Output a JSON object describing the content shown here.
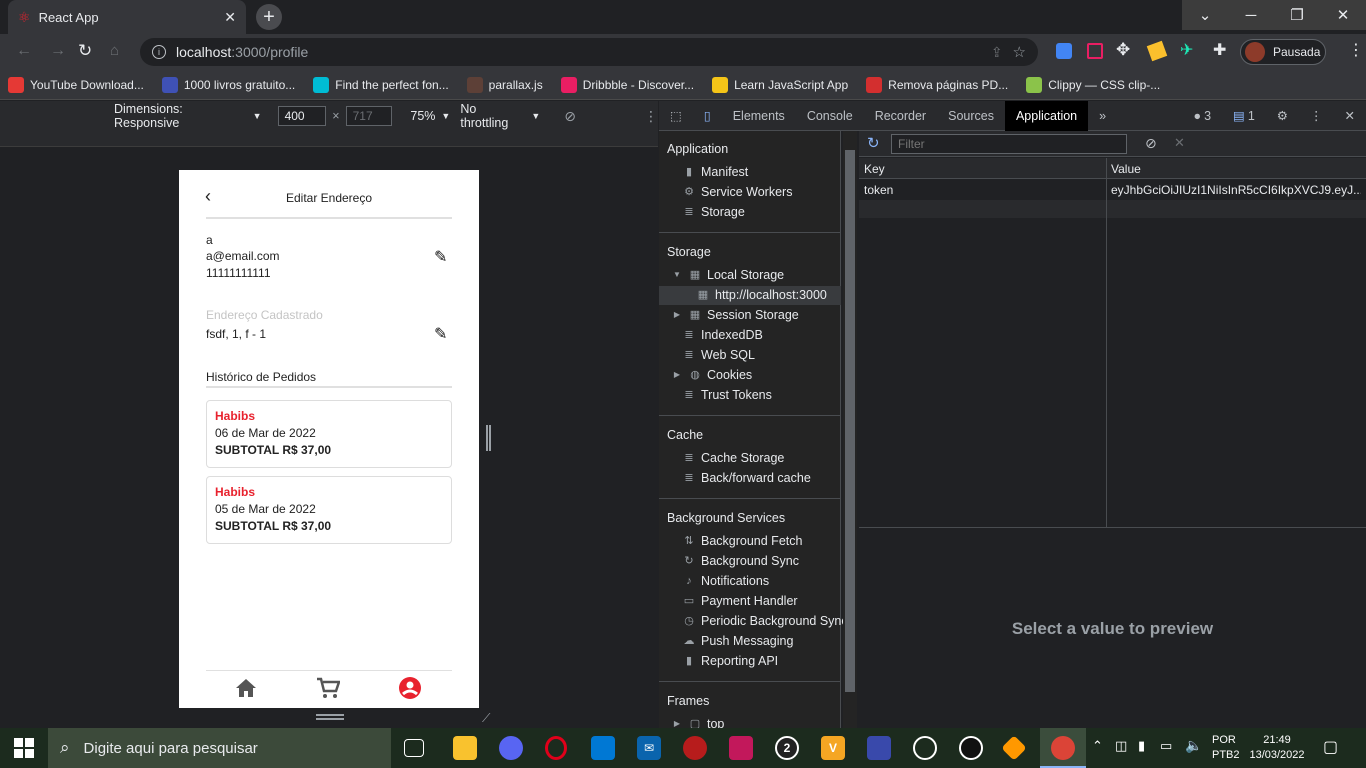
{
  "browser": {
    "tab_title": "React App",
    "url_host": "localhost",
    "url_rest": ":3000/profile",
    "profile_label": "Pausada",
    "bookmarks": [
      {
        "label": "YouTube Download...",
        "color": "#e53935"
      },
      {
        "label": "1000 livros gratuito...",
        "color": "#3f51b5"
      },
      {
        "label": "Find the perfect fon...",
        "color": "#00bcd4"
      },
      {
        "label": "parallax.js",
        "color": "#5d4037"
      },
      {
        "label": "Dribbble - Discover...",
        "color": "#e91e63"
      },
      {
        "label": "Learn JavaScript App",
        "color": "#f5c518"
      },
      {
        "label": "Remova páginas PD...",
        "color": "#d32f2f"
      },
      {
        "label": "Clippy — CSS clip-...",
        "color": "#8bc34a"
      }
    ]
  },
  "device_toolbar": {
    "dimensions_label": "Dimensions: Responsive",
    "width": "400",
    "times": "×",
    "height": "717",
    "zoom": "75%",
    "throttling": "No throttling"
  },
  "app": {
    "header_title": "Editar Endereço",
    "user_name": "a",
    "user_email": "a@email.com",
    "user_phone": "11111111111",
    "address_label": "Endereço Cadastrado",
    "address_value": "fsdf, 1, f - 1",
    "history_title": "Histórico de Pedidos",
    "orders": [
      {
        "restaurant": "Habibs",
        "date": "06 de Mar de 2022",
        "subtotal": "SUBTOTAL R$ 37,00"
      },
      {
        "restaurant": "Habibs",
        "date": "05 de Mar de 2022",
        "subtotal": "SUBTOTAL R$ 37,00"
      }
    ],
    "accent_color": "#e8222e"
  },
  "devtools": {
    "tabs": [
      "Elements",
      "Console",
      "Recorder",
      "Sources",
      "Application"
    ],
    "active_tab": "Application",
    "issues_count": "3",
    "messages_count": "1",
    "sidebar": {
      "application_header": "Application",
      "application_items": [
        "Manifest",
        "Service Workers",
        "Storage"
      ],
      "storage_header": "Storage",
      "local_storage": "Local Storage",
      "local_origin": "http://localhost:3000",
      "storage_items": [
        "Session Storage",
        "IndexedDB",
        "Web SQL",
        "Cookies",
        "Trust Tokens"
      ],
      "cache_header": "Cache",
      "cache_items": [
        "Cache Storage",
        "Back/forward cache"
      ],
      "bg_header": "Background Services",
      "bg_items": [
        "Background Fetch",
        "Background Sync",
        "Notifications",
        "Payment Handler",
        "Periodic Background Sync",
        "Push Messaging",
        "Reporting API"
      ],
      "frames_header": "Frames",
      "frames_top": "top"
    },
    "filter_placeholder": "Filter",
    "table": {
      "key_header": "Key",
      "value_header": "Value",
      "rows": [
        {
          "key": "token",
          "value": "eyJhbGciOiJIUzI1NiIsInR5cCI6IkpXVCJ9.eyJ..."
        }
      ]
    },
    "preview_text": "Select a value to preview"
  },
  "taskbar": {
    "search_placeholder": "Digite aqui para pesquisar",
    "lang1": "POR",
    "lang2": "PTB2",
    "time": "21:49",
    "date": "13/03/2022"
  }
}
